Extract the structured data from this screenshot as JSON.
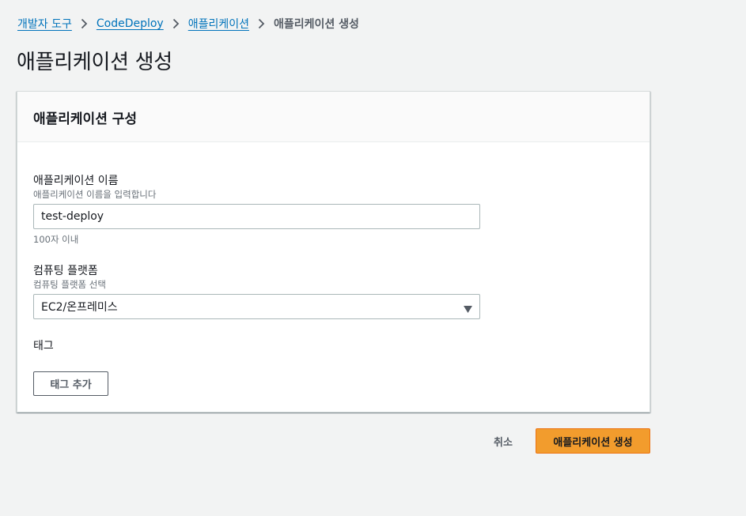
{
  "breadcrumb": {
    "items": [
      {
        "label": "개발자 도구"
      },
      {
        "label": "CodeDeploy"
      },
      {
        "label": "애플리케이션"
      }
    ],
    "current": "애플리케이션 생성"
  },
  "page": {
    "title": "애플리케이션 생성"
  },
  "panel": {
    "title": "애플리케이션 구성",
    "app_name": {
      "label": "애플리케이션 이름",
      "description": "애플리케이션 이름을 입력합니다",
      "value": "test-deploy",
      "constraint": "100자 이내"
    },
    "platform": {
      "label": "컴퓨팅 플랫폼",
      "description": "컴퓨팅 플랫폼 선택",
      "selected": "EC2/온프레미스",
      "icon": "caret-down-icon"
    },
    "tags": {
      "label": "태그",
      "add_button": "태그 추가"
    }
  },
  "actions": {
    "cancel": "취소",
    "create": "애플리케이션 생성"
  },
  "colors": {
    "background": "#f2f3f3",
    "link": "#0073bb",
    "primary_button": "#f29c2d",
    "primary_border": "#ec7211"
  }
}
